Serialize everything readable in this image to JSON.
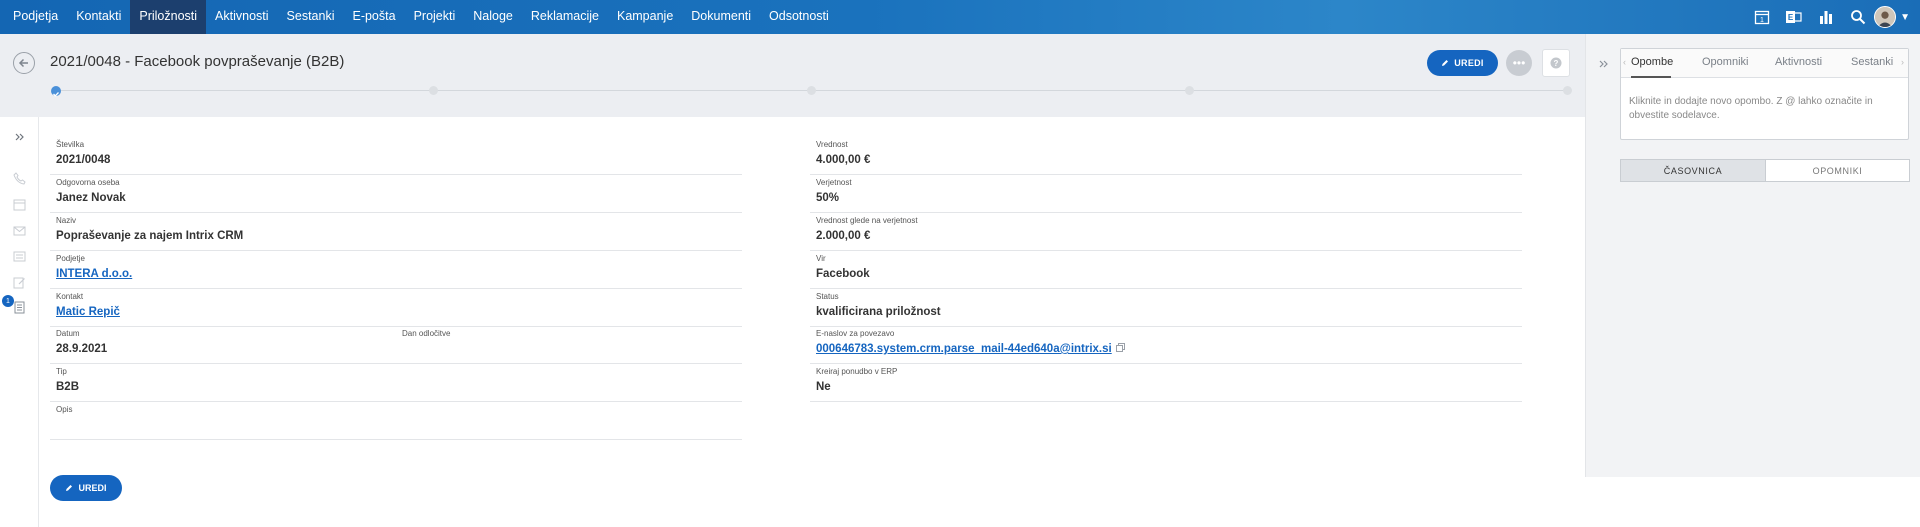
{
  "nav": {
    "items": [
      {
        "label": "Podjetja",
        "active": false
      },
      {
        "label": "Kontakti",
        "active": false
      },
      {
        "label": "Priložnosti",
        "active": true
      },
      {
        "label": "Aktivnosti",
        "active": false
      },
      {
        "label": "Sestanki",
        "active": false
      },
      {
        "label": "E-pošta",
        "active": false
      },
      {
        "label": "Projekti",
        "active": false
      },
      {
        "label": "Naloge",
        "active": false
      },
      {
        "label": "Reklamacije",
        "active": false
      },
      {
        "label": "Kampanje",
        "active": false
      },
      {
        "label": "Dokumenti",
        "active": false
      },
      {
        "label": "Odsotnosti",
        "active": false
      }
    ],
    "calendar_day": "1",
    "icons": [
      "calendar-icon",
      "exchange-icon",
      "reports-icon",
      "search-icon",
      "user-avatar"
    ]
  },
  "header": {
    "title": "2021/0048 - Facebook povpraševanje (B2B)",
    "edit_label": "UREDI",
    "more_label": "•••",
    "help_label": "?"
  },
  "rail": {
    "badge": "1",
    "icons": [
      "expand-icon",
      "phone-icon",
      "calendar-icon",
      "email-icon",
      "list-icon",
      "edit-note-icon",
      "document-icon"
    ]
  },
  "left_fields": {
    "number": {
      "label": "Številka",
      "value": "2021/0048"
    },
    "owner": {
      "label": "Odgovorna oseba",
      "value": "Janez Novak"
    },
    "name": {
      "label": "Naziv",
      "value": "Popraševanje za najem Intrix CRM"
    },
    "company": {
      "label": "Podjetje",
      "value": "INTERA d.o.o."
    },
    "contact": {
      "label": "Kontakt",
      "value": "Matic Repič"
    },
    "date": {
      "label": "Datum",
      "value": "28.9.2021"
    },
    "decision_day": {
      "label": "Dan odločitve",
      "value": ""
    },
    "type": {
      "label": "Tip",
      "value": "B2B"
    },
    "description": {
      "label": "Opis",
      "value": ""
    }
  },
  "right_fields": {
    "value": {
      "label": "Vrednost",
      "value": "4.000,00 €"
    },
    "probability": {
      "label": "Verjetnost",
      "value": "50%"
    },
    "weighted_value": {
      "label": "Vrednost glede na verjetnost",
      "value": "2.000,00 €"
    },
    "source": {
      "label": "Vir",
      "value": "Facebook"
    },
    "status": {
      "label": "Status",
      "value": "kvalificirana priložnost"
    },
    "email": {
      "label": "E-naslov za povezavo",
      "value": "000646783.system.crm.parse_mail-44ed640a@intrix.si"
    },
    "erp": {
      "label": "Kreiraj ponudbo v ERP",
      "value": "Ne"
    }
  },
  "bottom": {
    "edit_label": "UREDI"
  },
  "side_panel": {
    "tabs": [
      "Opombe",
      "Opomniki",
      "Aktivnosti",
      "Sestanki"
    ],
    "active_tab": "Opombe",
    "note_placeholder": "Kliknite in dodajte novo opombo. Z @ lahko označite in obvestite sodelavce.",
    "segments": {
      "timeline": "ČASOVNICA",
      "reminders": "OPOMNIKI"
    }
  },
  "colors": {
    "accent": "#1565c0",
    "nav_active": "#1c3f6e",
    "header_bg": "#eceef2"
  }
}
